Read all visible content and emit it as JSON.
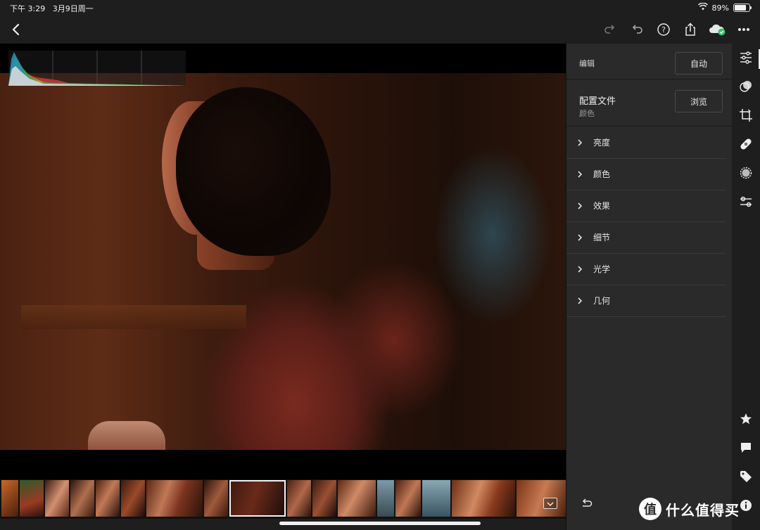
{
  "status_bar": {
    "time": "下午 3:29",
    "date": "3月9日周一",
    "battery": "89%",
    "battery_level": 0.89
  },
  "toolbar": {
    "back_icon": "chevron-left-icon",
    "actions": [
      "redo-icon",
      "undo-icon",
      "help-icon",
      "share-icon",
      "cloud-sync-icon",
      "more-icon"
    ]
  },
  "panel": {
    "edit_label": "编辑",
    "auto_button": "自动",
    "profile_title": "配置文件",
    "profile_value": "颜色",
    "browse_button": "浏览",
    "sections": [
      "亮度",
      "颜色",
      "效果",
      "细节",
      "光学",
      "几何"
    ]
  },
  "rail": {
    "top_tools": [
      "adjust-sliders-icon",
      "presets-icon",
      "crop-icon",
      "healing-icon",
      "selective-icon",
      "versions-icon"
    ],
    "bottom_tools": [
      "star-icon",
      "comment-icon",
      "tag-icon",
      "info-icon"
    ]
  },
  "watermark": {
    "text": "什么值得买",
    "logo": "值"
  },
  "colors": {
    "accent_green": "#32c36c",
    "panel": "#2a2a2a",
    "background": "#1e1e1e"
  }
}
